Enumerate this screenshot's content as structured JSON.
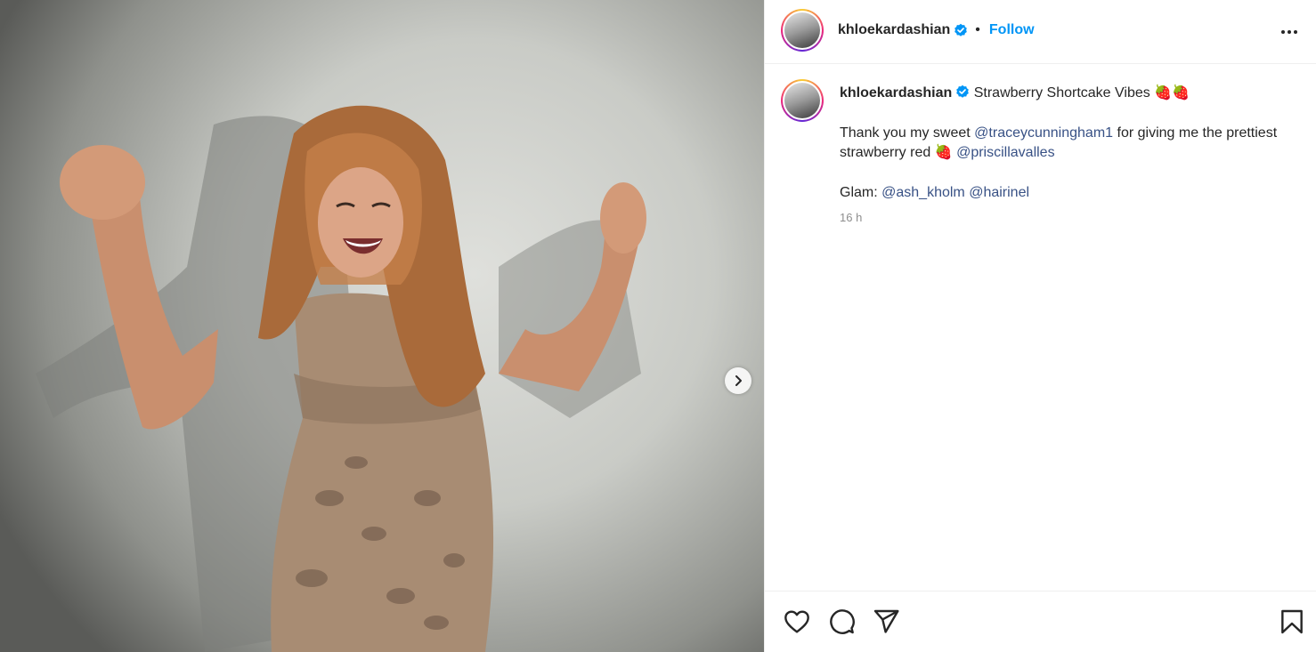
{
  "post": {
    "username": "khloekardashian",
    "verified": true,
    "separator": "•",
    "follow_label": "Follow",
    "more_icon": "more-horizontal-icon",
    "caption": {
      "title": "Strawberry Shortcake Vibes",
      "title_emoji": "🍓🍓",
      "line2_a": "Thank you my sweet ",
      "mention1": "@traceycunningham1",
      "line2_b": " for giving me the prettiest strawberry red ",
      "line2_emoji": "🍓",
      "mention2": "@priscillavalles",
      "glam_label": "Glam: ",
      "mention3": "@ash_kholm",
      "mention4": "@hairinel"
    },
    "timestamp": "16 h"
  },
  "actions": {
    "like_icon": "heart-icon",
    "comment_icon": "comment-icon",
    "share_icon": "send-icon",
    "save_icon": "bookmark-icon"
  },
  "media": {
    "next_icon": "chevron-right-icon"
  },
  "colors": {
    "accent": "#0095f6",
    "mention": "#385185",
    "verified": "#0095f6",
    "muted": "#8e8e8e"
  }
}
